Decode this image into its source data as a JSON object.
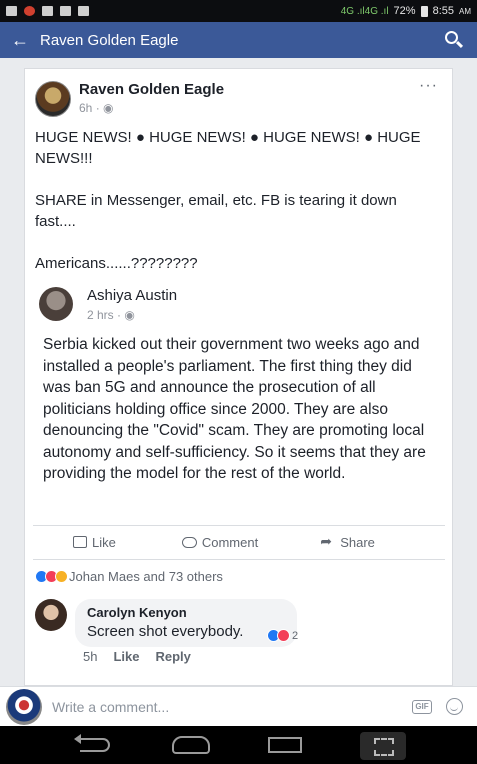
{
  "status_bar": {
    "battery": "72%",
    "network": "4G .ıl4G .ıl",
    "time": "8:55",
    "time_suffix": "AM"
  },
  "app_bar": {
    "back_icon": "arrow-left-icon",
    "title": "Raven Golden Eagle",
    "search_icon": "search-icon",
    "accent_color": "#3b5998"
  },
  "post": {
    "page_name": "Raven Golden Eagle",
    "time": "6h",
    "privacy_icon": "globe-icon",
    "more_label": "···",
    "paragraphs": [
      "HUGE NEWS! ● HUGE NEWS! ● HUGE NEWS! ● HUGE NEWS!!!",
      "SHARE in Messenger, email, etc. FB is tearing it down fast....",
      "Americans......????????"
    ],
    "shared": {
      "name": "Ashiya Austin",
      "time": "2 hrs",
      "body": "Serbia kicked out their government two weeks ago and installed a people's parliament. The first thing they did was ban 5G and announce the prosecution of all politicians holding office since 2000. They are also denouncing the \"Covid\" scam. They are promoting local autonomy and self-sufficiency. So it seems that they are providing the model for the rest of the world."
    },
    "actions": {
      "like": "Like",
      "comment": "Comment",
      "share": "Share"
    },
    "reactions_summary": "Johan Maes and 73 others"
  },
  "comment": {
    "name": "Carolyn Kenyon",
    "text": "Screen shot everybody.",
    "reaction_count": "2",
    "time": "5h",
    "like": "Like",
    "reply": "Reply"
  },
  "composer": {
    "placeholder": "Write a comment...",
    "gif_label": "GIF"
  }
}
